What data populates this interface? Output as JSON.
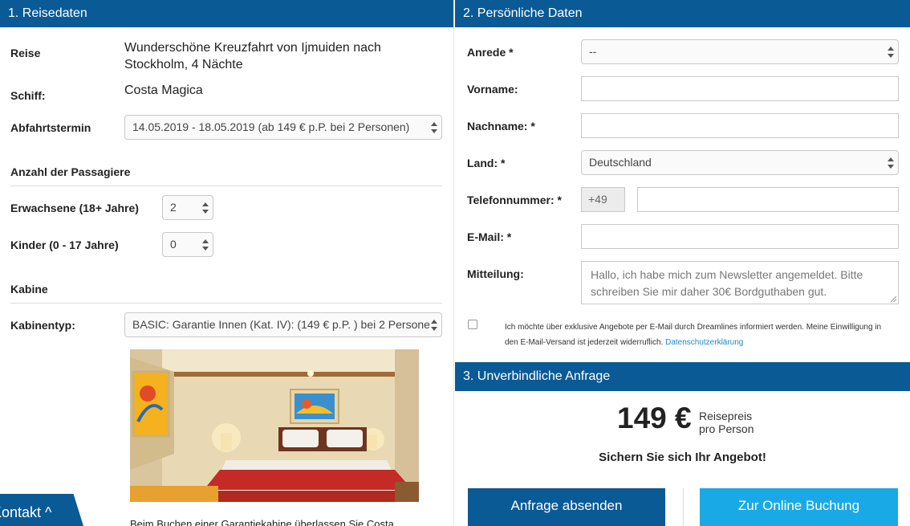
{
  "travel": {
    "header": "1. Reisedaten",
    "trip_label": "Reise",
    "trip_value_line1": "Wunderschöne Kreuzfahrt von Ijmuiden nach",
    "trip_value_line2": "Stockholm, 4 Nächte",
    "ship_label": "Schiff:",
    "ship_value": "Costa Magica",
    "departure_label": "Abfahrtstermin",
    "departure_value": "14.05.2019 - 18.05.2019 (ab 149 € p.P. bei 2 Personen)",
    "passengers_heading": "Anzahl der Passagiere",
    "adults_label": "Erwachsene (18+ Jahre)",
    "adults_value": "2",
    "children_label": "Kinder (0 - 17 Jahre)",
    "children_value": "0",
    "cabin_heading": "Kabine",
    "cabin_type_label": "Kabinentyp:",
    "cabin_type_value": "BASIC: Garantie Innen (Kat. IV): (149 € p.P. ) bei 2 Persone",
    "cabin_description": "Beim Buchen einer Garantiekabine überlassen Sie Costa"
  },
  "personal": {
    "header": "2. Persönliche Daten",
    "salutation_label": "Anrede *",
    "salutation_value": "--",
    "firstname_label": "Vorname:",
    "firstname_value": "",
    "lastname_label": "Nachname: *",
    "lastname_value": "",
    "country_label": "Land: *",
    "country_value": "Deutschland",
    "phone_label": "Telefonnummer: *",
    "phone_prefix": "+49",
    "phone_value": "",
    "email_label": "E-Mail: *",
    "email_value": "",
    "message_label": "Mitteilung:",
    "message_line1": "Hallo, ich habe mich zum Newsletter angemeldet. Bitte",
    "message_line2": "schreiben Sie mir daher 30€ Bordguthaben gut.",
    "consent_text": "Ich möchte über exklusive Angebote per E-Mail durch Dreamlines informiert werden. Meine Einwilligung in den E-Mail-Versand ist jederzeit widerruflich.",
    "privacy_link": "Datenschutzerklärung"
  },
  "request": {
    "header": "3. Unverbindliche Anfrage",
    "price": "149 €",
    "price_note_line1": "Reisepreis",
    "price_note_line2": "pro Person",
    "secure_text": "Sichern Sie sich Ihr Angebot!",
    "send_button": "Anfrage absenden",
    "online_button": "Zur Online Buchung"
  },
  "contact_tab": "Kontakt ^",
  "colors": {
    "primary": "#0a5a96",
    "accent": "#19a9e6",
    "link": "#1a8ad0"
  }
}
